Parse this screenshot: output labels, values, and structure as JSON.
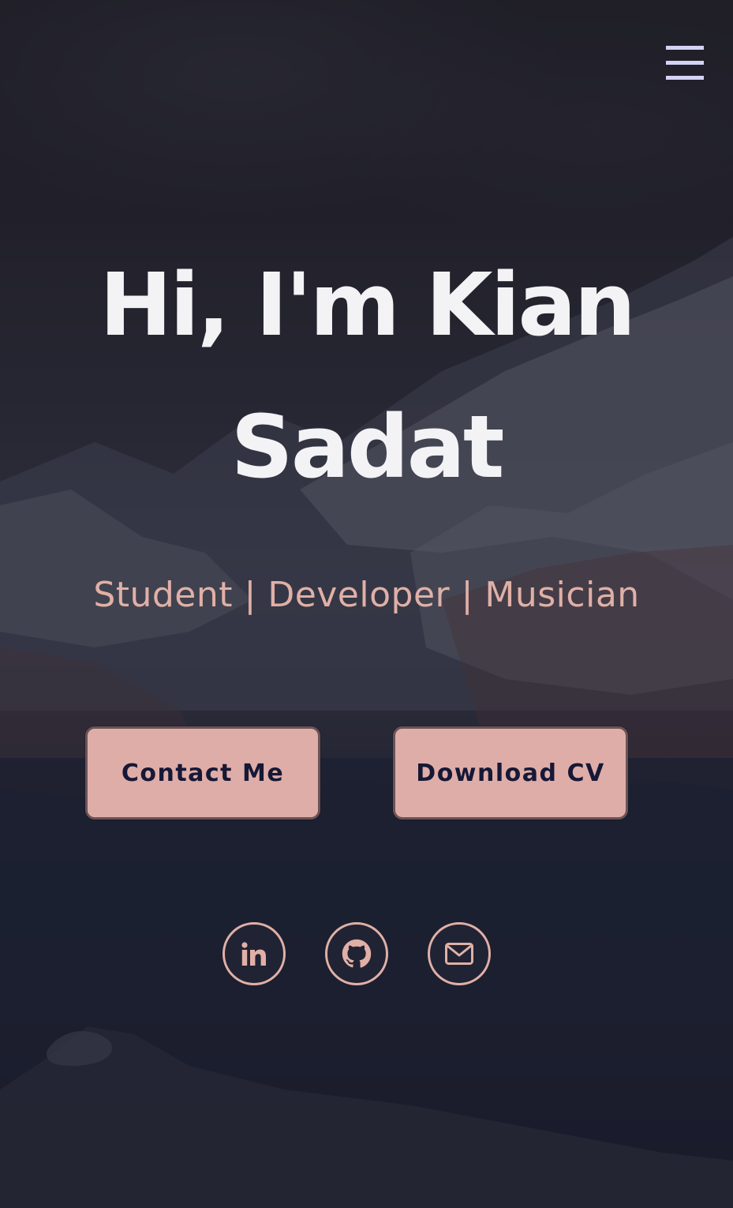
{
  "nav": {
    "menu_icon": "hamburger-menu-icon",
    "menu_color": "#d4d3f4"
  },
  "hero": {
    "title": "Hi, I'm Kian Sadat",
    "subtitle": "Student | Developer | Musician",
    "title_color": "#f3f3f5",
    "subtitle_color": "#e0b0a6"
  },
  "actions": {
    "contact_label": "Contact Me",
    "download_label": "Download CV",
    "button_color": "#dfada8",
    "button_text_color": "#161836"
  },
  "social": [
    {
      "name": "linkedin",
      "icon": "linkedin-icon"
    },
    {
      "name": "github",
      "icon": "github-icon"
    },
    {
      "name": "email",
      "icon": "mail-icon"
    }
  ],
  "accent_color": "#e0b0a6"
}
